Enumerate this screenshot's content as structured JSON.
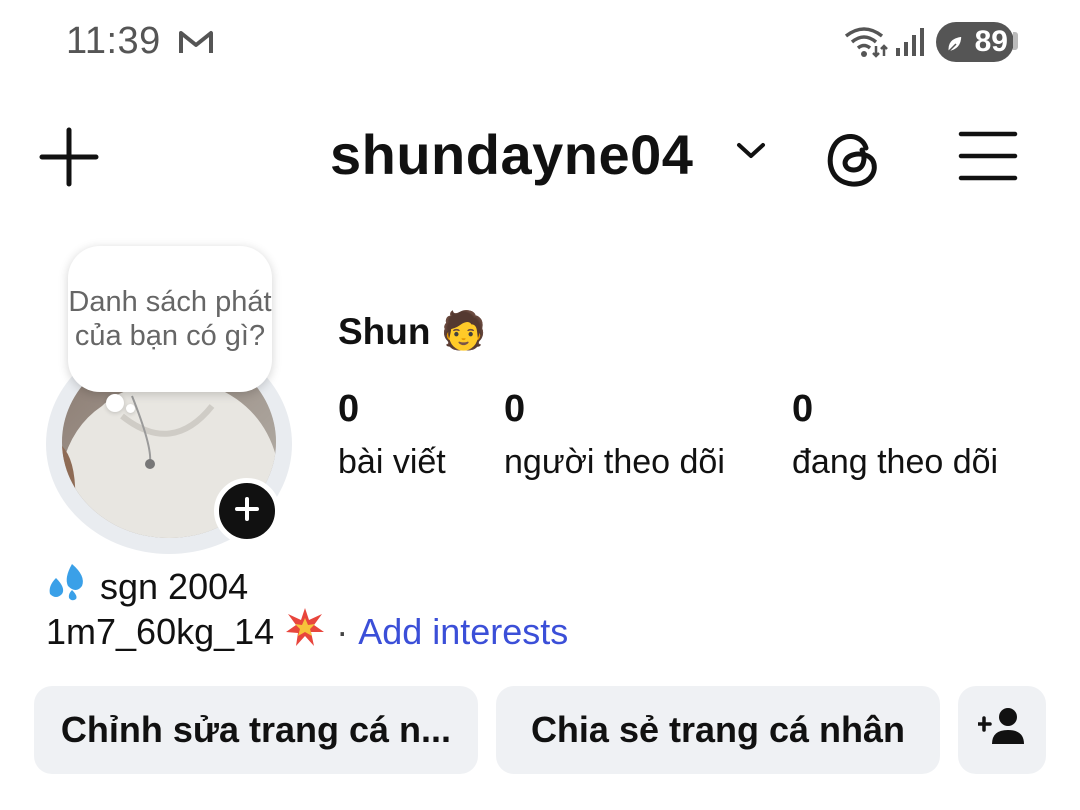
{
  "status_bar": {
    "time": "11:39",
    "battery": "89",
    "icons": [
      "gmail-icon",
      "wifi-icon",
      "signal-icon",
      "battery-icon"
    ]
  },
  "header": {
    "username": "shundayne04",
    "icons": [
      "plus-icon",
      "chevron-down-icon",
      "threads-icon",
      "menu-icon"
    ]
  },
  "note": {
    "text": "Danh sách phát của bạn có gì?"
  },
  "profile": {
    "display_name": "Shun",
    "display_emoji": "🧑",
    "stats": [
      {
        "value": "0",
        "label": "bài viết"
      },
      {
        "value": "0",
        "label": "người theo dõi"
      },
      {
        "value": "0",
        "label": "đang theo dõi"
      }
    ],
    "bio_line1": "sgn 2004",
    "bio_line2": "1m7_60kg_14",
    "separator": "·",
    "add_interests": "Add interests"
  },
  "buttons": {
    "edit_profile": "Chỉnh sửa trang cá n...",
    "share_profile": "Chia sẻ trang cá nhân"
  },
  "colors": {
    "link": "#3b4fd8",
    "button_bg": "#eff1f4",
    "text": "#111111"
  }
}
